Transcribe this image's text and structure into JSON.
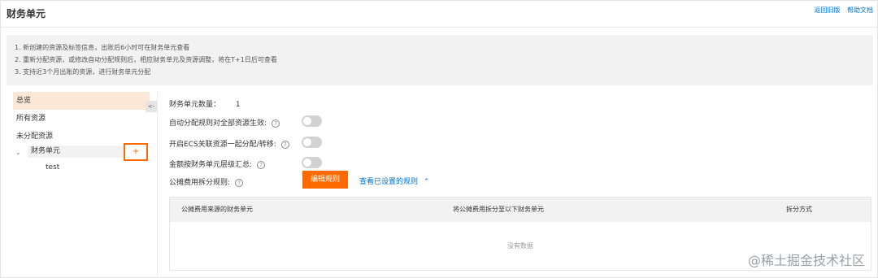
{
  "header": {
    "title": "财务单元",
    "links": [
      "返回旧版",
      "帮助文档"
    ]
  },
  "notice": [
    "1. 新创建的资源及标签信息，出账后6小时可在财务单元查看",
    "2. 重新分配资源，或修改自动分配规则后，相应财务单元及资源调整，将在T+1日后可查看",
    "3. 支持近3个月出账的资源，进行财务单元分配"
  ],
  "sidebar": {
    "items": [
      "总览",
      "所有资源",
      "未分配资源"
    ],
    "finance_unit": "财务单元",
    "add_glyph": "+",
    "child": "test",
    "collapse_glyph": "<-"
  },
  "settings": {
    "count_label": "财务单元数量：",
    "count_value": "1",
    "auto_rule_label": "自动分配规则对全部资源生效:",
    "ecs_label": "开启ECS关联资源一起分配/转移:",
    "amount_label": "金额按财务单元层级汇总:",
    "split_label": "公摊费用拆分规则:",
    "help_glyph": "?",
    "toggles": {
      "auto_rule": false,
      "ecs": false,
      "amount": false
    }
  },
  "actions": {
    "edit_rule": "编辑规则",
    "view_rules": "查看已设置的规则",
    "view_rules_chevron": "⌃"
  },
  "table": {
    "columns": [
      "公摊费用来源的财务单元",
      "将公摊费用拆分至以下财务单元",
      "拆分方式"
    ],
    "empty_text": "没有数据"
  },
  "watermark": "@稀土掘金技术社区",
  "colors": {
    "accent": "#ff6a00",
    "link": "#0070cc",
    "active_bg": "#fde7d7"
  }
}
